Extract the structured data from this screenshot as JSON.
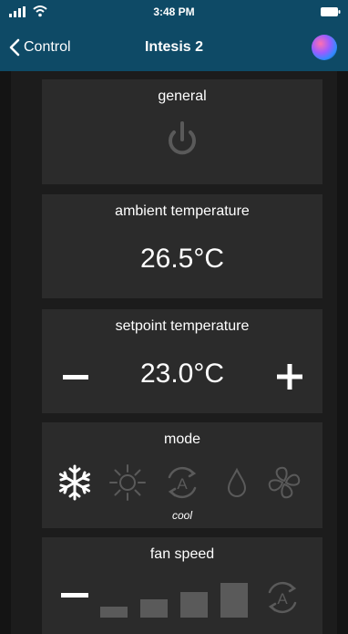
{
  "status_bar": {
    "time": "3:48 PM"
  },
  "nav": {
    "back_label": "Control",
    "title": "Intesis 2"
  },
  "general": {
    "title": "general",
    "power_on": false
  },
  "ambient": {
    "title": "ambient temperature",
    "value": "26.5°C"
  },
  "setpoint": {
    "title": "setpoint temperature",
    "value": "23.0°C"
  },
  "mode": {
    "title": "mode",
    "selected_label": "cool",
    "options": [
      "snowflake-icon",
      "sun-icon",
      "auto-icon",
      "drop-icon",
      "fan-icon"
    ],
    "selected_index": 0
  },
  "fan_speed": {
    "title": "fan speed"
  },
  "colors": {
    "header": "#0e4a66",
    "card": "#2b2b2b",
    "background": "#1c1c1c",
    "active_icon": "#ffffff",
    "inactive_icon": "#5a5a5a"
  }
}
